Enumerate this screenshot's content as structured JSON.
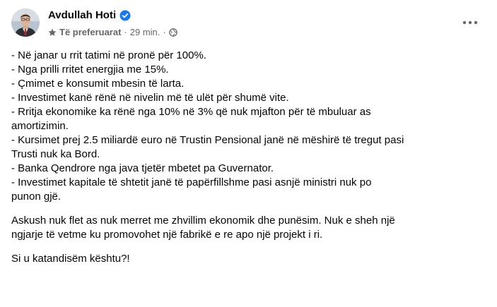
{
  "post": {
    "author": "Avdullah Hoti",
    "audience_label": "Të preferuarat",
    "time": "29 min.",
    "separator": "·",
    "icons": {
      "verified": "verified-badge-icon",
      "favorites": "star-icon",
      "privacy": "globe-icon",
      "more": "more-horizontal-icon"
    },
    "colors": {
      "verified": "#1877f2",
      "secondary_text": "#65676b",
      "primary_text": "#050505"
    },
    "bullets": [
      "- Në janar u rrit tatimi në pronë për 100%.",
      "- Nga prilli rritet energjia me 15%.",
      "- Çmimet e konsumit mbesin të larta.",
      "- Investimet kanë rënë në nivelin më të ulët për shumë vite.",
      "- Rritja ekonomike ka rënë nga 10% në 3% që nuk mjafton për të mbuluar as",
      "amortizimin.",
      "- Kursimet prej 2.5 miliardë euro në Trustin Pensional janë në mëshirë të tregut pasi",
      "Trusti nuk ka Bord.",
      "- Banka Qendrore nga java tjetër mbetet pa Guvernator.",
      "- Investimet kapitale të shtetit janë të papërfillshme pasi asnjë ministri nuk po",
      "punon gjë."
    ],
    "paragraph2": [
      "Askush nuk flet as nuk merret me zhvillim ekonomik dhe punësim. Nuk e sheh një",
      "ngjarje të vetme ku promovohet një fabrikë e re apo një projekt i ri."
    ],
    "paragraph3": [
      "Si u katandisëm kështu?!"
    ]
  }
}
